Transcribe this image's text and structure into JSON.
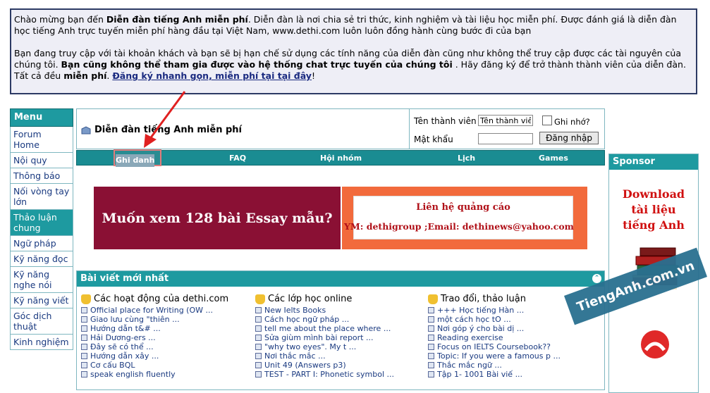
{
  "welcome": {
    "p1_a": "Chào mừng bạn đến ",
    "p1_b": "Diễn đàn tiếng Anh miễn phí",
    "p1_c": ". Diễn đàn là nơi chia sẻ tri thức, kinh nghiệm và tài liệu học miễn phí. Được đánh giá là diễn đàn học tiếng Anh trực tuyến miễn phí hàng đầu tại Việt Nam, www.dethi.com luôn luôn đồng hành cùng bước đi của bạn",
    "p2_a": "Bạn đang truy cập với tài khoản khách và bạn sẽ bị hạn chế sử dụng các tính năng của diễn đàn cũng như không thể truy cập được các tài nguyên của chúng tôi. ",
    "p2_b": "Bạn cũng không thể tham gia được vào hệ thống chat trực tuyến của chúng tôi",
    "p2_c": " . Hãy đăng ký để trở thành thành viên của diễn đàn. Tất cả đều ",
    "p2_d": "miễn phí",
    "p2_e": ". ",
    "p2_link": "Đăng ký nhanh gọn, miễn phí tại tại đây",
    "p2_f": "!"
  },
  "menu": {
    "title": "Menu",
    "items": [
      "Forum Home",
      "Nội quy",
      "Thông báo",
      "Nối vòng tay lớn",
      "Thảo luận chung",
      "Ngữ pháp",
      "Kỹ năng đọc",
      "Kỹ năng nghe nói",
      "Kỹ năng viết",
      "Góc dịch thuật",
      "Kinh nghiệm"
    ]
  },
  "header": {
    "title": "Diễn đàn tiếng Anh miễn phí",
    "username_label": "Tên thành viên",
    "username_value": "Tên thành viê",
    "password_label": "Mật khẩu",
    "remember_label": "Ghi nhớ?",
    "login_button": "Đăng nhập"
  },
  "nav": {
    "register": "Ghi danh",
    "faq": "FAQ",
    "groups": "Hội nhóm",
    "calendar": "Lịch",
    "games": "Games"
  },
  "banners": {
    "left": "Muốn xem 128 bài Essay mẫu?",
    "right_line1": "Liên hệ quảng cáo",
    "right_line2": "YM: dethigroup ;Email: dethinews@yahoo.com"
  },
  "recent": {
    "title": "Bài viết mới nhất",
    "columns": [
      {
        "title": "Các hoạt động của dethi.com",
        "posts": [
          "Official place for Writing (OW ...",
          "Giao lưu cùng \"thiên ...",
          "Hướng dẫn t&# ...",
          "Hải Dương-ers ...",
          "Đây sẽ có thể ...",
          "Hướng dẫn xây ...",
          "Cơ cấu BQL",
          "speak english fluently"
        ]
      },
      {
        "title": "Các lớp học online",
        "posts": [
          "New Ielts Books",
          "Cách học ngữ pháp ...",
          "tell me about the place where ...",
          "Sửa giùm mình bài report ...",
          "\"why two eyes\". My t ...",
          "Nơi thắc mắc ...",
          "Unit 49 (Answers p3)",
          "TEST - PART I: Phonetic symbol ..."
        ]
      },
      {
        "title": "Trao đổi, thảo luận",
        "posts": [
          "+++ Học tiếng Hàn ...",
          "một cách học tO ...",
          "Nơi góp ý cho bài dị ...",
          "Reading exercise",
          "Focus on IELTS Coursebook??",
          "Topic: If you were a famous p ...",
          "Thắc mắc ngữ ...",
          "Tập 1- 1001 Bài viế ..."
        ]
      }
    ]
  },
  "sponsor": {
    "title": "Sponsor",
    "text_line1": "Download",
    "text_line2": "tài liệu",
    "text_line3": "tiếng Anh"
  },
  "watermark": "TiengAnh.com.vn",
  "colors": {
    "teal": "#1e9aa0",
    "maroon": "#8a1034",
    "orange": "#f26a3c",
    "arrow_red": "#e02020"
  }
}
